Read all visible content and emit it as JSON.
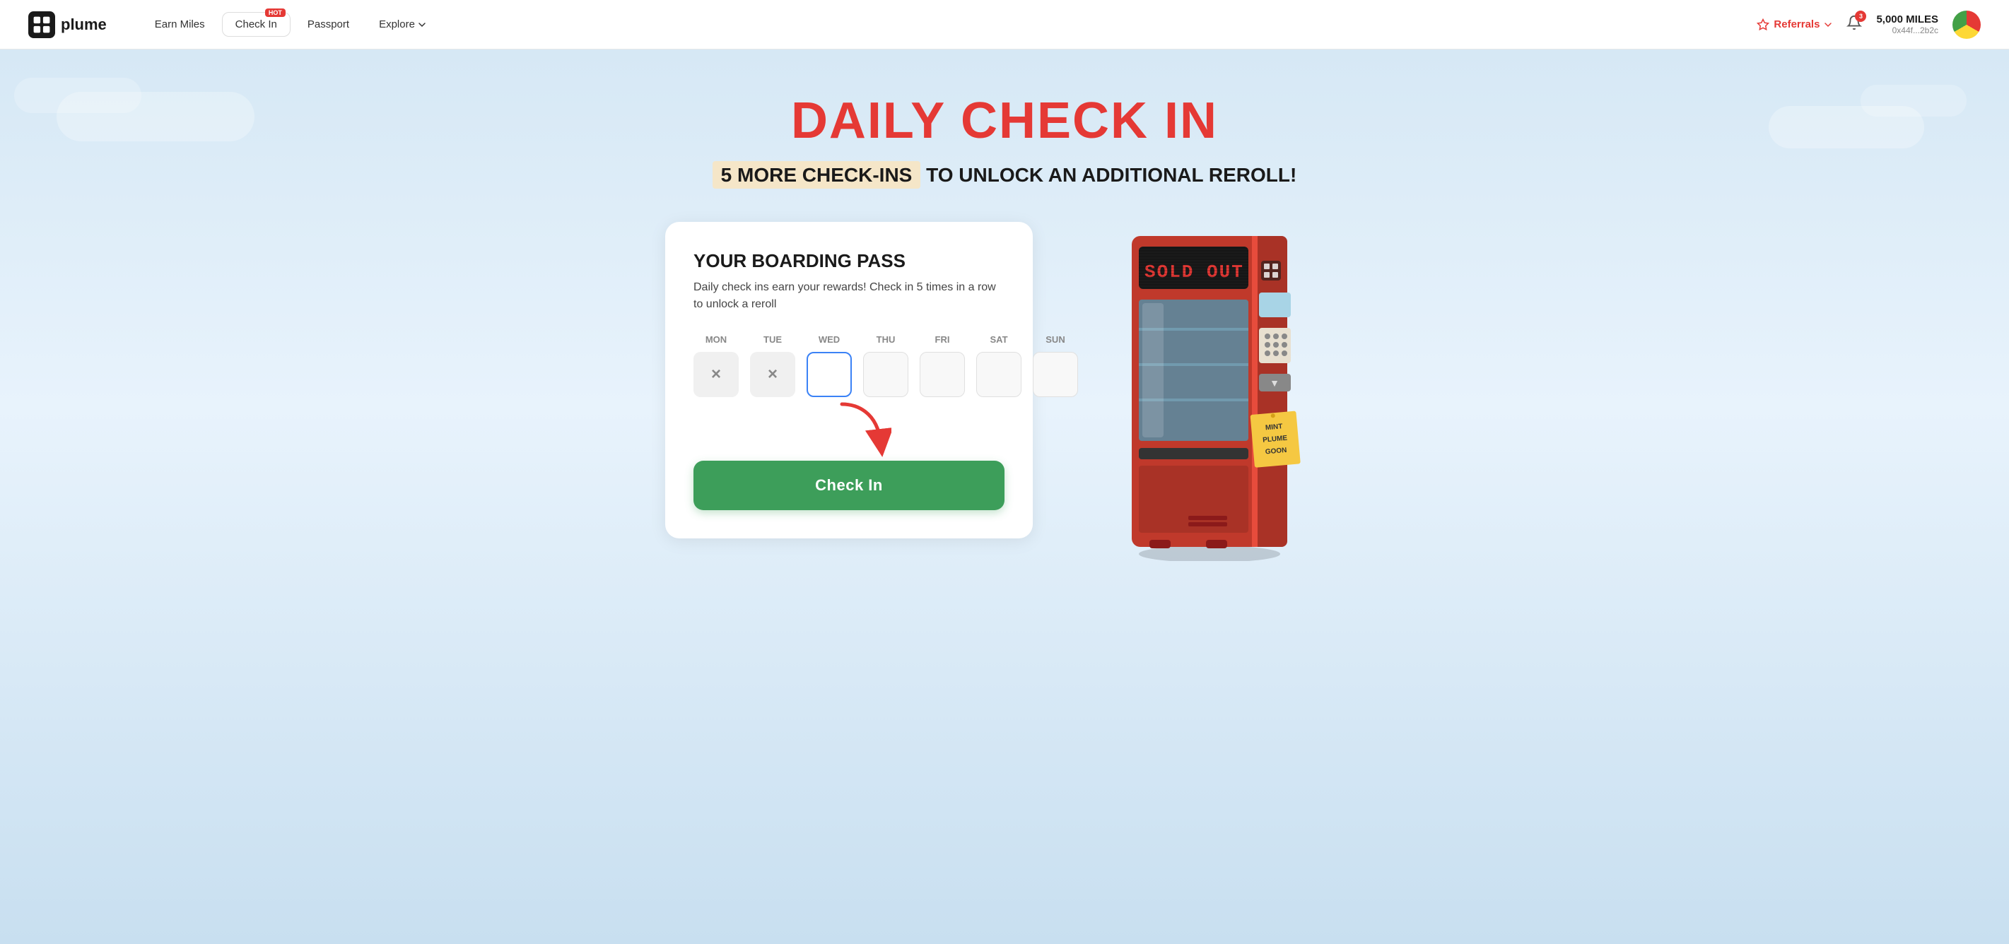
{
  "navbar": {
    "logo_text": "plume",
    "links": [
      {
        "id": "earn-miles",
        "label": "Earn Miles",
        "active": false,
        "hot": false
      },
      {
        "id": "check-in",
        "label": "Check In",
        "active": true,
        "hot": true
      },
      {
        "id": "passport",
        "label": "Passport",
        "active": false,
        "hot": false
      },
      {
        "id": "explore",
        "label": "Explore",
        "active": false,
        "hot": false,
        "dropdown": true
      }
    ],
    "referrals_label": "Referrals",
    "notification_count": "3",
    "miles_amount": "5,000 MILES",
    "wallet_address": "0x44f...2b2c",
    "hot_badge": "HOT"
  },
  "hero": {
    "title": "DAILY CHECK IN",
    "subtitle_prefix": "5 MORE CHECK-INS",
    "subtitle_suffix": " TO UNLOCK AN ADDITIONAL REROLL!"
  },
  "boarding_pass": {
    "title": "YOUR BOARDING PASS",
    "description": "Daily check ins earn your rewards! Check in 5 times in a row to unlock a reroll",
    "days": [
      {
        "label": "MON",
        "state": "checked",
        "symbol": "×"
      },
      {
        "label": "TUE",
        "state": "checked",
        "symbol": "×"
      },
      {
        "label": "WED",
        "state": "current",
        "symbol": ""
      },
      {
        "label": "THU",
        "state": "empty",
        "symbol": ""
      },
      {
        "label": "FRI",
        "state": "empty",
        "symbol": ""
      },
      {
        "label": "SAT",
        "state": "empty",
        "symbol": ""
      },
      {
        "label": "SUN",
        "state": "empty",
        "symbol": ""
      }
    ],
    "checkin_button": "Check In"
  },
  "vending_machine": {
    "sold_out_text": "SOLD OUT",
    "note_line1": "MINT",
    "note_line2": "PLUME",
    "note_line3": "GOON"
  }
}
